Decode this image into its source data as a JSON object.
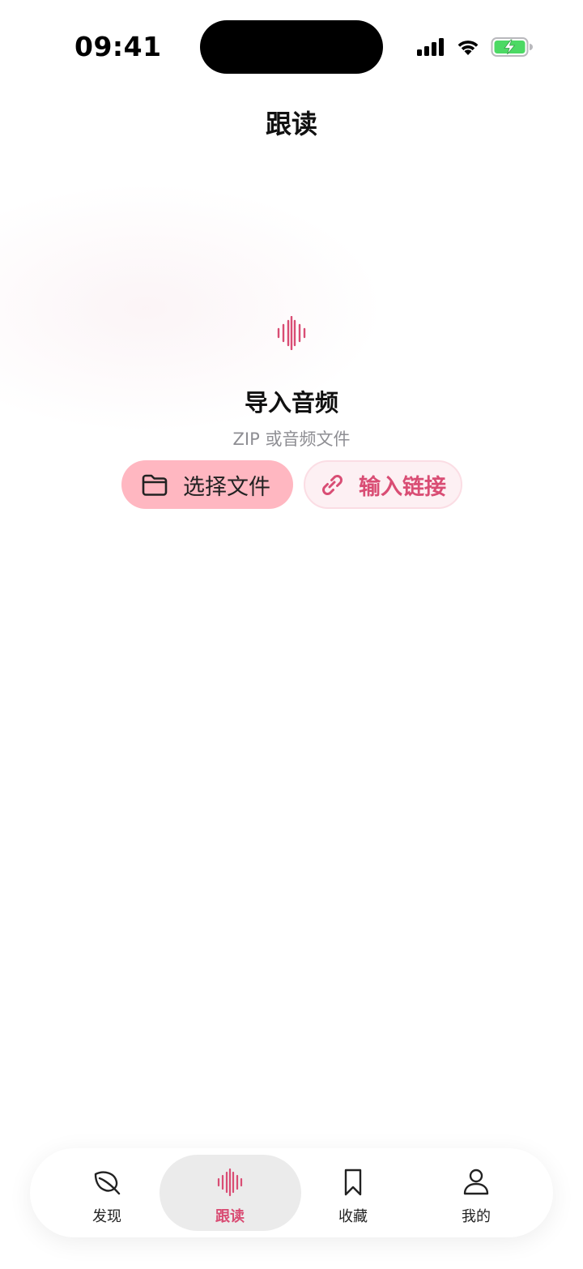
{
  "status_bar": {
    "time": "09:41",
    "icons": [
      "cellular-signal-icon",
      "wifi-icon",
      "battery-charging-icon"
    ]
  },
  "header": {
    "title": "跟读"
  },
  "import_panel": {
    "icon": "audio-waveform-icon",
    "title": "导入音频",
    "subtitle": "ZIP 或音频文件",
    "choose_file_label": "选择文件",
    "enter_link_label": "输入链接"
  },
  "tab_bar": {
    "active_index": 1,
    "tabs": [
      {
        "label": "发现",
        "icon": "leaf-icon"
      },
      {
        "label": "跟读",
        "icon": "audio-waveform-icon"
      },
      {
        "label": "收藏",
        "icon": "bookmark-icon"
      },
      {
        "label": "我的",
        "icon": "person-icon"
      }
    ]
  },
  "colors": {
    "accent": "#d94d74",
    "primary_button_bg": "#ffb7c1",
    "secondary_button_bg": "#fdf0f3",
    "battery_green": "#4cd964",
    "subtitle_gray": "#8e8e93",
    "active_tab_bg": "#ebebeb"
  }
}
